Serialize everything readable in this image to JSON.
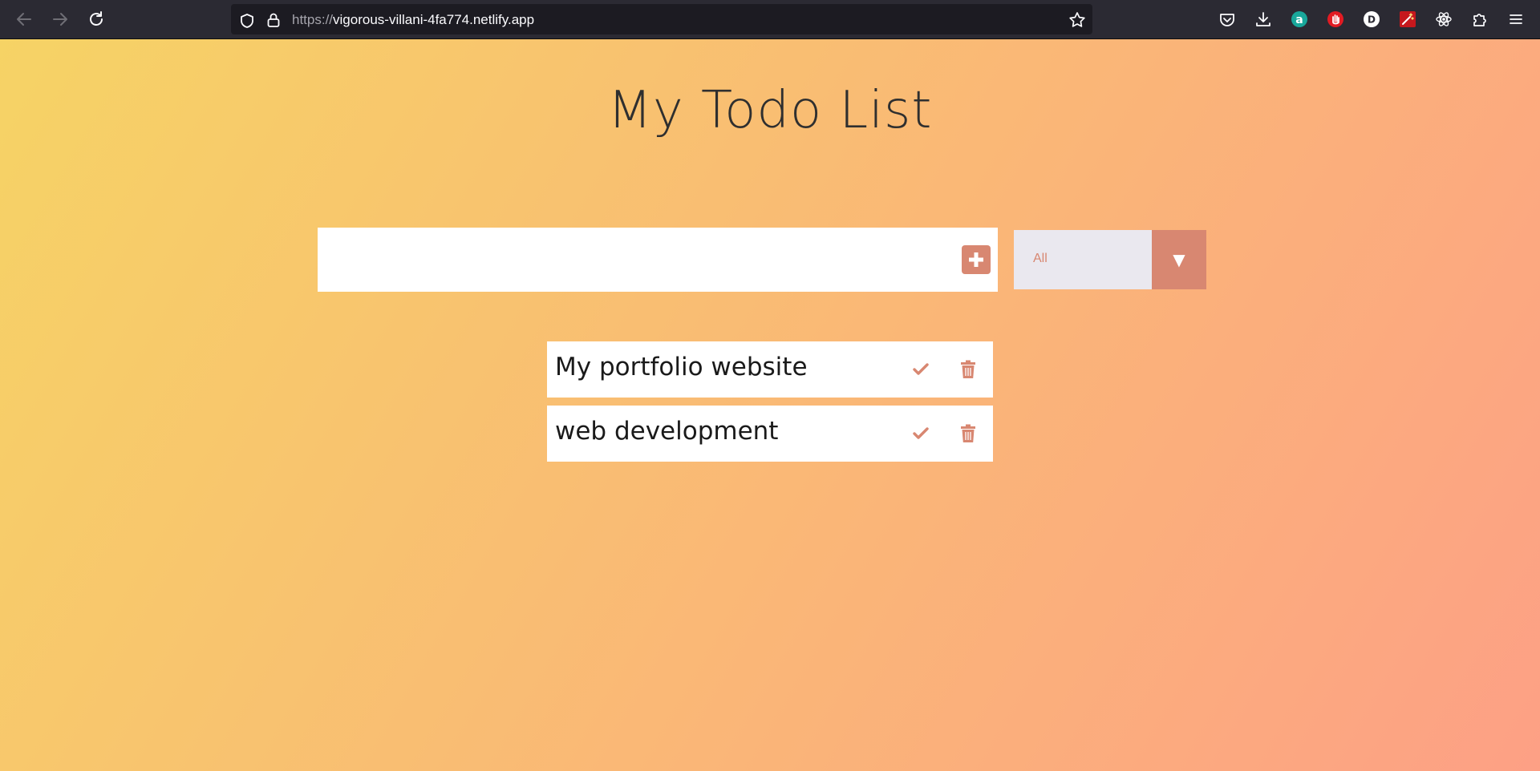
{
  "browser": {
    "url_scheme": "https://",
    "url_host": "vigorous-villani-4fa774.netlify.app"
  },
  "page": {
    "title": "My Todo List",
    "input": {
      "value": "",
      "placeholder": ""
    },
    "filter": {
      "selected": "All"
    },
    "todos": [
      {
        "text": "My portfolio website"
      },
      {
        "text": "web development"
      }
    ]
  },
  "colors": {
    "accent": "#d88771",
    "gradient_start": "#f6d365",
    "gradient_end": "#fda085"
  },
  "icons": {
    "back": "arrow-left-icon",
    "forward": "arrow-right-icon",
    "reload": "reload-icon",
    "shield": "shield-icon",
    "lock": "lock-icon",
    "bookmark": "star-icon",
    "pocket": "pocket-icon",
    "downloads": "download-icon",
    "ext1": "amazon-extension-icon",
    "ext2": "hand-extension-icon",
    "ext3": "d-extension-icon",
    "ext4": "wand-extension-icon",
    "ext5": "react-devtools-icon",
    "extensions": "puzzle-icon",
    "menu": "hamburger-menu-icon",
    "add": "plus-square-icon",
    "check": "check-icon",
    "trash": "trash-icon"
  }
}
